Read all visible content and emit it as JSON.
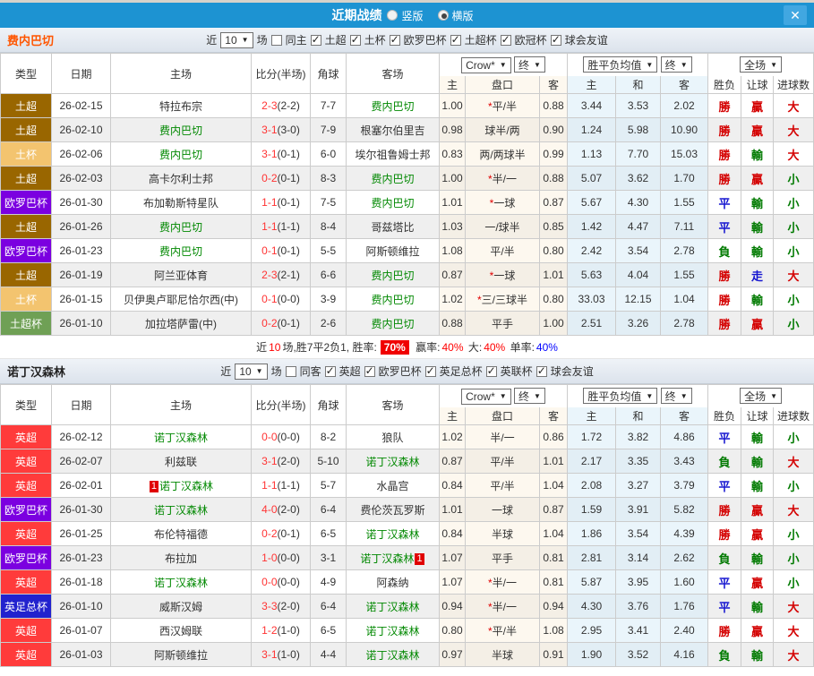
{
  "header": {
    "title": "近期战绩",
    "vertical_label": "竖版",
    "horizontal_label": "横版",
    "selected_mode": "横版",
    "close_label": "✕"
  },
  "table": {
    "main_headers": [
      "类型",
      "日期",
      "主场",
      "比分(半场)",
      "角球",
      "客场"
    ],
    "sub_headers": [
      "主",
      "盘口",
      "客",
      "主",
      "和",
      "客",
      "胜负",
      "让球",
      "进球数"
    ],
    "selects": {
      "company": "Crow*",
      "final_a": "终",
      "mean": "胜平负均值",
      "final_b": "终",
      "scope": "全场"
    }
  },
  "filter_labels": {
    "near": "近",
    "count": "10",
    "games": "场"
  },
  "league_colors": {
    "土超": "#996600",
    "土杯": "#F3C46F",
    "欧罗巴杯": "#7B00E0",
    "土超杯": "#6FA055",
    "英超": "#FF3B3B",
    "英足总杯": "#2222CE"
  },
  "result_colors": {
    "勝": "#D40000",
    "贏": "#D40000",
    "大": "#D40000",
    "平": "#1515D0",
    "走": "#1515D0",
    "負": "#007A00",
    "輸": "#007A00",
    "小": "#007A00"
  },
  "sections": [
    {
      "team": "费内巴切",
      "team_color": "#FF5500",
      "same_label": "同主",
      "same_checked": false,
      "leagues": [
        "土超",
        "土杯",
        "欧罗巴杯",
        "土超杯",
        "欧冠杯",
        "球会友谊"
      ],
      "rows": [
        {
          "league": "土超",
          "date": "26-02-15",
          "home": "特拉布宗",
          "home_self": false,
          "home_badge": "",
          "score": "2-3",
          "half": "(2-2)",
          "corner": "7-7",
          "away": "费内巴切",
          "away_self": true,
          "away_badge": "",
          "o1": "1.00",
          "handicap": "*平/半",
          "o2": "0.88",
          "m1": "3.44",
          "m2": "3.53",
          "m3": "2.02",
          "r1": "勝",
          "r2": "贏",
          "r3": "大"
        },
        {
          "league": "土超",
          "date": "26-02-10",
          "home": "费内巴切",
          "home_self": true,
          "home_badge": "",
          "score": "3-1",
          "half": "(3-0)",
          "corner": "7-9",
          "away": "根塞尔伯里吉",
          "away_self": false,
          "away_badge": "",
          "o1": "0.98",
          "handicap": "球半/两",
          "o2": "0.90",
          "m1": "1.24",
          "m2": "5.98",
          "m3": "10.90",
          "r1": "勝",
          "r2": "贏",
          "r3": "大"
        },
        {
          "league": "土杯",
          "date": "26-02-06",
          "home": "费内巴切",
          "home_self": true,
          "home_badge": "",
          "score": "3-1",
          "half": "(0-1)",
          "corner": "6-0",
          "away": "埃尔祖鲁姆士邦",
          "away_self": false,
          "away_badge": "",
          "o1": "0.83",
          "handicap": "两/两球半",
          "o2": "0.99",
          "m1": "1.13",
          "m2": "7.70",
          "m3": "15.03",
          "r1": "勝",
          "r2": "輸",
          "r3": "大"
        },
        {
          "league": "土超",
          "date": "26-02-03",
          "home": "高卡尔利士邦",
          "home_self": false,
          "home_badge": "",
          "score": "0-2",
          "half": "(0-1)",
          "corner": "8-3",
          "away": "费内巴切",
          "away_self": true,
          "away_badge": "",
          "o1": "1.00",
          "handicap": "*半/一",
          "o2": "0.88",
          "m1": "5.07",
          "m2": "3.62",
          "m3": "1.70",
          "r1": "勝",
          "r2": "贏",
          "r3": "小"
        },
        {
          "league": "欧罗巴杯",
          "date": "26-01-30",
          "home": "布加勒斯特星队",
          "home_self": false,
          "home_badge": "",
          "score": "1-1",
          "half": "(0-1)",
          "corner": "7-5",
          "away": "费内巴切",
          "away_self": true,
          "away_badge": "",
          "o1": "1.01",
          "handicap": "*一球",
          "o2": "0.87",
          "m1": "5.67",
          "m2": "4.30",
          "m3": "1.55",
          "r1": "平",
          "r2": "輸",
          "r3": "小"
        },
        {
          "league": "土超",
          "date": "26-01-26",
          "home": "费内巴切",
          "home_self": true,
          "home_badge": "",
          "score": "1-1",
          "half": "(1-1)",
          "corner": "8-4",
          "away": "哥兹塔比",
          "away_self": false,
          "away_badge": "",
          "o1": "1.03",
          "handicap": "一/球半",
          "o2": "0.85",
          "m1": "1.42",
          "m2": "4.47",
          "m3": "7.11",
          "r1": "平",
          "r2": "輸",
          "r3": "小"
        },
        {
          "league": "欧罗巴杯",
          "date": "26-01-23",
          "home": "费内巴切",
          "home_self": true,
          "home_badge": "",
          "score": "0-1",
          "half": "(0-1)",
          "corner": "5-5",
          "away": "阿斯顿维拉",
          "away_self": false,
          "away_badge": "",
          "o1": "1.08",
          "handicap": "平/半",
          "o2": "0.80",
          "m1": "2.42",
          "m2": "3.54",
          "m3": "2.78",
          "r1": "負",
          "r2": "輸",
          "r3": "小"
        },
        {
          "league": "土超",
          "date": "26-01-19",
          "home": "阿兰亚体育",
          "home_self": false,
          "home_badge": "",
          "score": "2-3",
          "half": "(2-1)",
          "corner": "6-6",
          "away": "费内巴切",
          "away_self": true,
          "away_badge": "",
          "o1": "0.87",
          "handicap": "*一球",
          "o2": "1.01",
          "m1": "5.63",
          "m2": "4.04",
          "m3": "1.55",
          "r1": "勝",
          "r2": "走",
          "r3": "大"
        },
        {
          "league": "土杯",
          "date": "26-01-15",
          "home": "贝伊奥卢耶尼恰尔西(中)",
          "home_self": false,
          "home_badge": "",
          "score": "0-1",
          "half": "(0-0)",
          "corner": "3-9",
          "away": "费内巴切",
          "away_self": true,
          "away_badge": "",
          "o1": "1.02",
          "handicap": "*三/三球半",
          "o2": "0.80",
          "m1": "33.03",
          "m2": "12.15",
          "m3": "1.04",
          "r1": "勝",
          "r2": "輸",
          "r3": "小"
        },
        {
          "league": "土超杯",
          "date": "26-01-10",
          "home": "加拉塔萨雷(中)",
          "home_self": false,
          "home_badge": "",
          "score": "0-2",
          "half": "(0-1)",
          "corner": "2-6",
          "away": "费内巴切",
          "away_self": true,
          "away_badge": "",
          "o1": "0.88",
          "handicap": "平手",
          "o2": "1.00",
          "m1": "2.51",
          "m2": "3.26",
          "m3": "2.78",
          "r1": "勝",
          "r2": "贏",
          "r3": "小"
        }
      ],
      "summary": {
        "near": "近",
        "count": "10",
        "body": "场,胜7平2负1, 胜率:",
        "win_rate": "70%",
        "win_lbl": "赢率:",
        "win_val": "40%",
        "big_lbl": "大:",
        "big_val": "40%",
        "single_lbl": "单率:",
        "single_val": "40%"
      }
    },
    {
      "team": "诺丁汉森林",
      "team_color": "#222222",
      "same_label": "同客",
      "same_checked": false,
      "leagues": [
        "英超",
        "欧罗巴杯",
        "英足总杯",
        "英联杯",
        "球会友谊"
      ],
      "rows": [
        {
          "league": "英超",
          "date": "26-02-12",
          "home": "诺丁汉森林",
          "home_self": true,
          "home_badge": "",
          "score": "0-0",
          "half": "(0-0)",
          "corner": "8-2",
          "away": "狼队",
          "away_self": false,
          "away_badge": "",
          "o1": "1.02",
          "handicap": "半/一",
          "o2": "0.86",
          "m1": "1.72",
          "m2": "3.82",
          "m3": "4.86",
          "r1": "平",
          "r2": "輸",
          "r3": "小"
        },
        {
          "league": "英超",
          "date": "26-02-07",
          "home": "利兹联",
          "home_self": false,
          "home_badge": "",
          "score": "3-1",
          "half": "(2-0)",
          "corner": "5-10",
          "away": "诺丁汉森林",
          "away_self": true,
          "away_badge": "",
          "o1": "0.87",
          "handicap": "平/半",
          "o2": "1.01",
          "m1": "2.17",
          "m2": "3.35",
          "m3": "3.43",
          "r1": "負",
          "r2": "輸",
          "r3": "大"
        },
        {
          "league": "英超",
          "date": "26-02-01",
          "home": "诺丁汉森林",
          "home_self": true,
          "home_badge": "1",
          "score": "1-1",
          "half": "(1-1)",
          "corner": "5-7",
          "away": "水晶宫",
          "away_self": false,
          "away_badge": "",
          "o1": "0.84",
          "handicap": "平/半",
          "o2": "1.04",
          "m1": "2.08",
          "m2": "3.27",
          "m3": "3.79",
          "r1": "平",
          "r2": "輸",
          "r3": "小"
        },
        {
          "league": "欧罗巴杯",
          "date": "26-01-30",
          "home": "诺丁汉森林",
          "home_self": true,
          "home_badge": "",
          "score": "4-0",
          "half": "(2-0)",
          "corner": "6-4",
          "away": "费伦茨瓦罗斯",
          "away_self": false,
          "away_badge": "",
          "o1": "1.01",
          "handicap": "一球",
          "o2": "0.87",
          "m1": "1.59",
          "m2": "3.91",
          "m3": "5.82",
          "r1": "勝",
          "r2": "贏",
          "r3": "大"
        },
        {
          "league": "英超",
          "date": "26-01-25",
          "home": "布伦特福德",
          "home_self": false,
          "home_badge": "",
          "score": "0-2",
          "half": "(0-1)",
          "corner": "6-5",
          "away": "诺丁汉森林",
          "away_self": true,
          "away_badge": "",
          "o1": "0.84",
          "handicap": "半球",
          "o2": "1.04",
          "m1": "1.86",
          "m2": "3.54",
          "m3": "4.39",
          "r1": "勝",
          "r2": "贏",
          "r3": "小"
        },
        {
          "league": "欧罗巴杯",
          "date": "26-01-23",
          "home": "布拉加",
          "home_self": false,
          "home_badge": "",
          "score": "1-0",
          "half": "(0-0)",
          "corner": "3-1",
          "away": "诺丁汉森林",
          "away_self": true,
          "away_badge": "1",
          "o1": "1.07",
          "handicap": "平手",
          "o2": "0.81",
          "m1": "2.81",
          "m2": "3.14",
          "m3": "2.62",
          "r1": "負",
          "r2": "輸",
          "r3": "小"
        },
        {
          "league": "英超",
          "date": "26-01-18",
          "home": "诺丁汉森林",
          "home_self": true,
          "home_badge": "",
          "score": "0-0",
          "half": "(0-0)",
          "corner": "4-9",
          "away": "阿森纳",
          "away_self": false,
          "away_badge": "",
          "o1": "1.07",
          "handicap": "*半/一",
          "o2": "0.81",
          "m1": "5.87",
          "m2": "3.95",
          "m3": "1.60",
          "r1": "平",
          "r2": "贏",
          "r3": "小"
        },
        {
          "league": "英足总杯",
          "date": "26-01-10",
          "home": "威斯汉姆",
          "home_self": false,
          "home_badge": "",
          "score": "3-3",
          "half": "(2-0)",
          "corner": "6-4",
          "away": "诺丁汉森林",
          "away_self": true,
          "away_badge": "",
          "o1": "0.94",
          "handicap": "*半/一",
          "o2": "0.94",
          "m1": "4.30",
          "m2": "3.76",
          "m3": "1.76",
          "r1": "平",
          "r2": "輸",
          "r3": "大"
        },
        {
          "league": "英超",
          "date": "26-01-07",
          "home": "西汉姆联",
          "home_self": false,
          "home_badge": "",
          "score": "1-2",
          "half": "(1-0)",
          "corner": "6-5",
          "away": "诺丁汉森林",
          "away_self": true,
          "away_badge": "",
          "o1": "0.80",
          "handicap": "*平/半",
          "o2": "1.08",
          "m1": "2.95",
          "m2": "3.41",
          "m3": "2.40",
          "r1": "勝",
          "r2": "贏",
          "r3": "大"
        },
        {
          "league": "英超",
          "date": "26-01-03",
          "home": "阿斯顿维拉",
          "home_self": false,
          "home_badge": "",
          "score": "3-1",
          "half": "(1-0)",
          "corner": "4-4",
          "away": "诺丁汉森林",
          "away_self": true,
          "away_badge": "",
          "o1": "0.97",
          "handicap": "半球",
          "o2": "0.91",
          "m1": "1.90",
          "m2": "3.52",
          "m3": "4.16",
          "r1": "負",
          "r2": "輸",
          "r3": "大"
        }
      ],
      "summary": null
    }
  ]
}
